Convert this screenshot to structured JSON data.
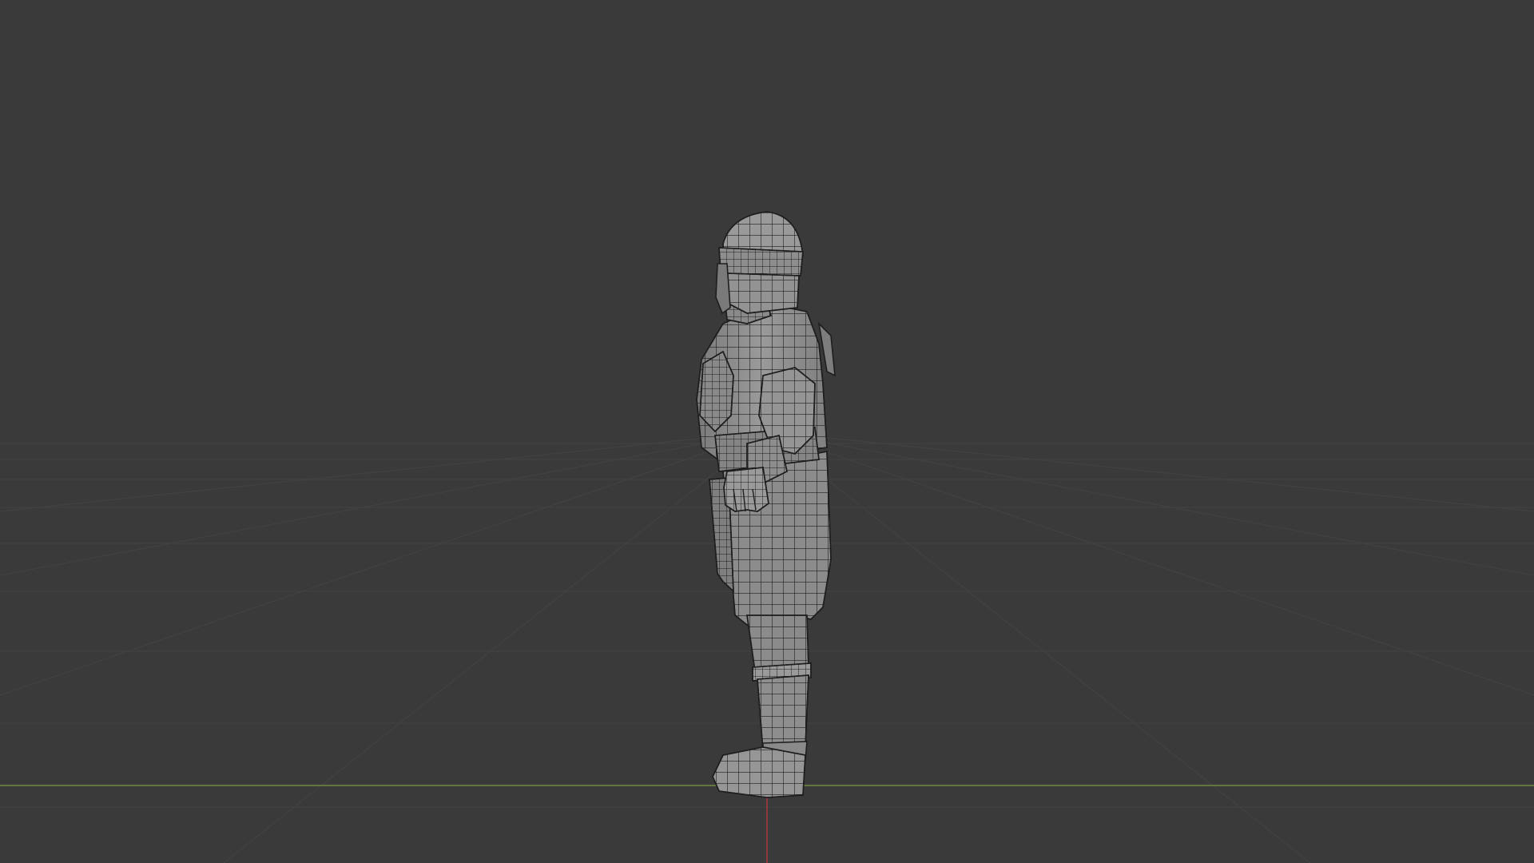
{
  "viewport": {
    "mode": "3d-viewport",
    "shading": "wireframe-over-solid",
    "view": "side-orthographic",
    "subject": "armored-warrior-character-mesh",
    "grid_visible": true
  },
  "colors": {
    "background": "#3a3a3a",
    "grid_line": "#434343",
    "x_axis": "#6f8a3f",
    "z_axis": "#a83a3a",
    "mesh_fill": "#8f8f8f",
    "mesh_shade": "#6f6f6f",
    "wireframe": "#1e1e1e"
  }
}
